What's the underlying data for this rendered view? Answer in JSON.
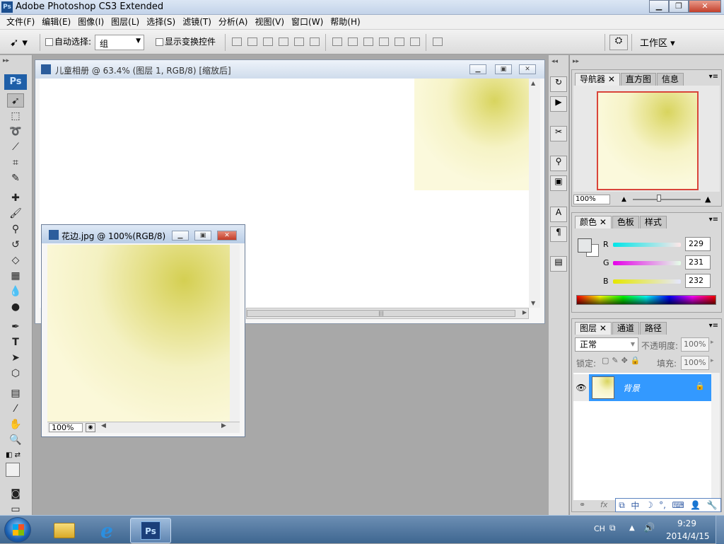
{
  "window": {
    "logo": "Ps",
    "title": "Adobe Photoshop CS3 Extended"
  },
  "menu": [
    "文件(F)",
    "编辑(E)",
    "图像(I)",
    "图层(L)",
    "选择(S)",
    "滤镜(T)",
    "分析(A)",
    "视图(V)",
    "窗口(W)",
    "帮助(H)"
  ],
  "options": {
    "auto_select_label": "自动选择:",
    "auto_select_value": "组",
    "show_transform_label": "显示变换控件",
    "workspace_label": "工作区 ▾"
  },
  "doc1": {
    "title": "儿童相册 @ 63.4% (图层 1, RGB/8) [缩放后]"
  },
  "doc2": {
    "title": "花边.jpg @ 100%(RGB/8)",
    "zoom": "100%"
  },
  "navigator": {
    "tabs": [
      "导航器",
      "直方图",
      "信息"
    ],
    "zoom": "100%"
  },
  "color": {
    "tabs": [
      "颜色",
      "色板",
      "样式"
    ],
    "r_label": "R",
    "g_label": "G",
    "b_label": "B",
    "r": "229",
    "g": "231",
    "b": "232"
  },
  "layers": {
    "tabs": [
      "图层",
      "通道",
      "路径"
    ],
    "blend_mode": "正常",
    "opacity_label": "不透明度:",
    "opacity": "100%",
    "lock_label": "锁定:",
    "fill_label": "填充:",
    "fill": "100%",
    "layer_name": "背景"
  },
  "ime": {
    "items": [
      "中",
      "☽",
      "°,",
      "⌨",
      "👤",
      "🔧"
    ]
  },
  "taskbar": {
    "lang": "CH",
    "time": "9:29",
    "date": "2014/4/15"
  },
  "icons": {
    "start": "windows-orb-icon",
    "explorer": "folder-icon",
    "ie": "ie-icon",
    "ps": "photoshop-icon"
  }
}
